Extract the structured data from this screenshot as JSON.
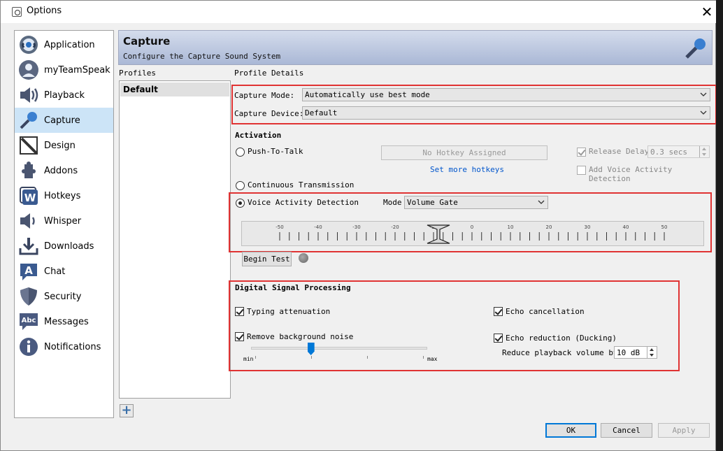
{
  "window": {
    "title": "Options"
  },
  "nav": {
    "items": [
      {
        "label": "Application",
        "icon": "teamspeak-logo-icon"
      },
      {
        "label": "myTeamSpeak",
        "icon": "user-icon"
      },
      {
        "label": "Playback",
        "icon": "speaker-icon"
      },
      {
        "label": "Capture",
        "icon": "microphone-icon"
      },
      {
        "label": "Design",
        "icon": "design-icon"
      },
      {
        "label": "Addons",
        "icon": "puzzle-icon"
      },
      {
        "label": "Hotkeys",
        "icon": "hotkey-w-icon"
      },
      {
        "label": "Whisper",
        "icon": "whisper-icon"
      },
      {
        "label": "Downloads",
        "icon": "download-icon"
      },
      {
        "label": "Chat",
        "icon": "chat-a-icon"
      },
      {
        "label": "Security",
        "icon": "shield-icon"
      },
      {
        "label": "Messages",
        "icon": "abc-bubble-icon"
      },
      {
        "label": "Notifications",
        "icon": "info-icon"
      }
    ],
    "active_index": 3
  },
  "header": {
    "title": "Capture",
    "subtitle": "Configure the Capture Sound System"
  },
  "profiles": {
    "label": "Profiles",
    "items": [
      "Default"
    ]
  },
  "details": {
    "label": "Profile Details",
    "capture_mode_label": "Capture Mode:",
    "capture_mode_value": "Automatically use best mode",
    "capture_device_label": "Capture Device:",
    "capture_device_value": "Default"
  },
  "activation": {
    "title": "Activation",
    "push_to_talk": "Push-To-Talk",
    "hotkey_button": "No Hotkey Assigned",
    "set_hotkeys": "Set more hotkeys",
    "release_delay": "Release Delay",
    "release_delay_value": "0.3 secs",
    "add_vad": "Add Voice Activity Detection",
    "continuous": "Continuous Transmission",
    "vad": "Voice Activity Detection",
    "mode_label": "Mode",
    "mode_value": "Volume Gate",
    "scale_labels": [
      "-50",
      "-40",
      "-30",
      "-20",
      "-10",
      "0",
      "10",
      "20",
      "30",
      "40",
      "50"
    ],
    "gate_value": -10,
    "begin_test": "Begin Test"
  },
  "dsp": {
    "title": "Digital Signal Processing",
    "typing": "Typing attenuation",
    "echo_cancel": "Echo cancellation",
    "remove_noise": "Remove background noise",
    "noise_level": 0.34,
    "slider_min": "min",
    "slider_max": "max",
    "echo_reduction": "Echo reduction (Ducking)",
    "reduce_label": "Reduce playback volume by:",
    "reduce_value": "10 dB"
  },
  "buttons": {
    "ok": "OK",
    "cancel": "Cancel",
    "apply": "Apply"
  }
}
